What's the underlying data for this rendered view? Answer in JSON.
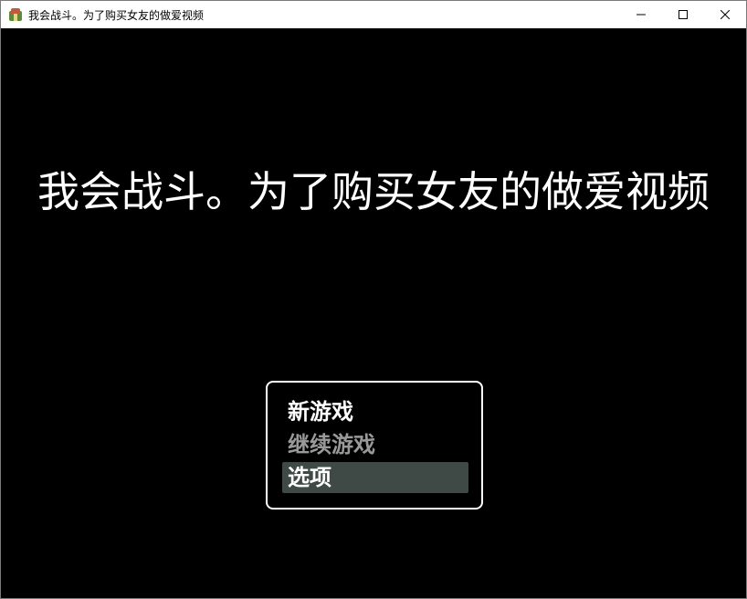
{
  "window": {
    "title": "我会战斗。为了购买女友的做爱视频",
    "controls": {
      "minimize": "—",
      "maximize": "☐",
      "close": "✕"
    }
  },
  "game": {
    "title": "我会战斗。为了购买女友的做爱视频",
    "menu": {
      "items": [
        {
          "label": "新游戏",
          "enabled": true,
          "selected": false
        },
        {
          "label": "继续游戏",
          "enabled": false,
          "selected": false
        },
        {
          "label": "选项",
          "enabled": true,
          "selected": true
        }
      ]
    }
  },
  "colors": {
    "background": "#000000",
    "text": "#ffffff",
    "disabled_text": "#999999",
    "selection": "#3f4a47"
  }
}
